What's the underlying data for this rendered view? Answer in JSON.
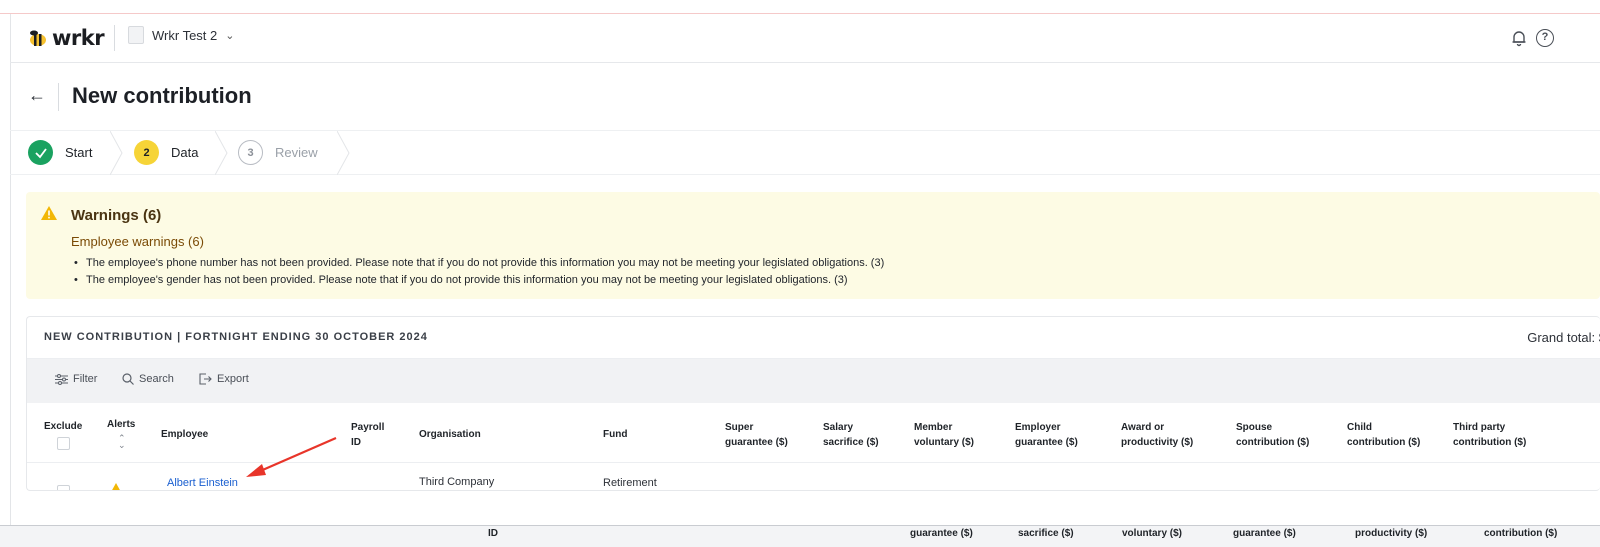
{
  "header": {
    "logo_text": "wrkr",
    "org_name": "Wrkr Test 2"
  },
  "page": {
    "title": "New contribution"
  },
  "stepper": {
    "steps": [
      {
        "label": "Start",
        "state": "done",
        "number": ""
      },
      {
        "label": "Data",
        "state": "active",
        "number": "2"
      },
      {
        "label": "Review",
        "state": "pending",
        "number": "3"
      }
    ]
  },
  "warnings": {
    "title": "Warnings (6)",
    "subtitle": "Employee warnings (6)",
    "items": [
      "The employee's phone number has not been provided. Please note that if you do not provide this information you may not be meeting your legislated obligations. (3)",
      "The employee's gender has not been provided. Please note that if you do not provide this information you may not be meeting your legislated obligations. (3)"
    ]
  },
  "table": {
    "title": "NEW CONTRIBUTION | FORTNIGHT ENDING 30 OCTOBER 2024",
    "grand_total_label": "Grand total: $",
    "toolbar": {
      "filter": "Filter",
      "search": "Search",
      "export": "Export"
    },
    "columns": {
      "exclude": "Exclude",
      "alerts": "Alerts",
      "employee": "Employee",
      "payroll_1": "Payroll",
      "payroll_2": "ID",
      "organisation": "Organisation",
      "fund": "Fund",
      "super_1": "Super",
      "super_2": "guarantee ($)",
      "salary_1": "Salary",
      "salary_2": "sacrifice ($)",
      "member_1": "Member",
      "member_2": "voluntary ($)",
      "employer_1": "Employer",
      "employer_2": "guarantee ($)",
      "award_1": "Award or",
      "award_2": "productivity ($)",
      "spouse_1": "Spouse",
      "spouse_2": "contribution ($)",
      "child_1": "Child",
      "child_2": "contribution ($)",
      "third_1": "Third party",
      "third_2": "contribution ($)"
    },
    "rows": [
      {
        "employee": "Albert Einstein",
        "organisation": "Third Company",
        "fund": "Retirement"
      }
    ]
  },
  "bottom_bar": {
    "labels": [
      "ID",
      "guarantee ($)",
      "sacrifice ($)",
      "voluntary ($)",
      "guarantee ($)",
      "productivity ($)",
      "contribution ($)"
    ]
  },
  "colors": {
    "accent_yellow": "#f6d437",
    "success_green": "#1aa260",
    "warning_bg": "#fdfbe4",
    "link_blue": "#1a5fd0",
    "annotation_red": "#e8352a"
  }
}
